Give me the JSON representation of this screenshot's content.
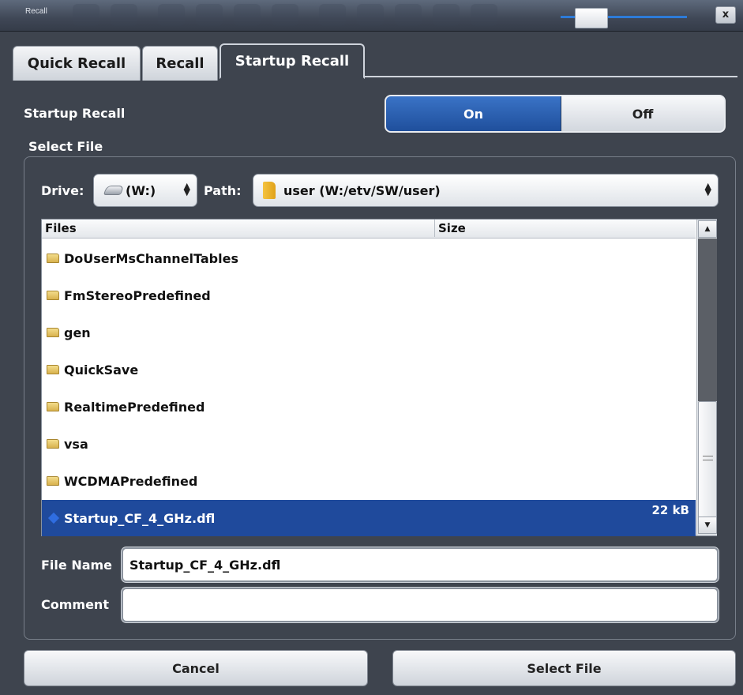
{
  "window": {
    "title": "Recall",
    "close_label": "x"
  },
  "tabs": [
    {
      "label": "Quick Recall"
    },
    {
      "label": "Recall"
    },
    {
      "label": "Startup Recall"
    }
  ],
  "startup_recall": {
    "label": "Startup Recall",
    "on_label": "On",
    "off_label": "Off",
    "selected": "On"
  },
  "select_file": {
    "label": "Select File",
    "drive_label": "Drive:",
    "drive_value": "(W:)",
    "path_label": "Path:",
    "path_value": "user (W:/etv/SW/user)",
    "columns": {
      "files": "Files",
      "size": "Size"
    },
    "rows": [
      {
        "name": "DoUserMsChannelTables",
        "size": ""
      },
      {
        "name": "FmStereoPredefined",
        "size": ""
      },
      {
        "name": "gen",
        "size": ""
      },
      {
        "name": "QuickSave",
        "size": ""
      },
      {
        "name": "RealtimePredefined",
        "size": ""
      },
      {
        "name": "vsa",
        "size": ""
      },
      {
        "name": "WCDMAPredefined",
        "size": ""
      },
      {
        "name": "Startup_CF_4_GHz.dfl",
        "size": "22 kB"
      }
    ],
    "file_name_label": "File Name",
    "file_name_value": "Startup_CF_4_GHz.dfl",
    "comment_label": "Comment",
    "comment_value": ""
  },
  "buttons": {
    "cancel": "Cancel",
    "select_file": "Select File"
  },
  "colors": {
    "accent": "#1f4a9c",
    "dialog_bg": "#3e444e"
  }
}
